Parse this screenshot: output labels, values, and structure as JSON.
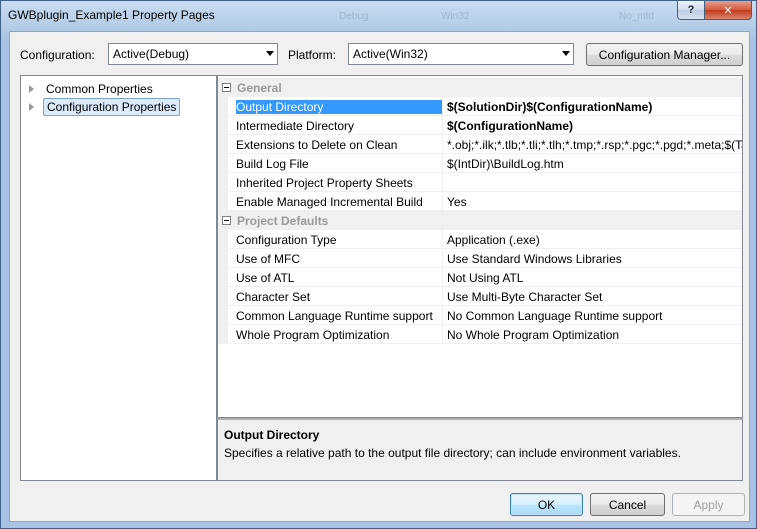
{
  "window": {
    "title": "GWBplugin_Example1 Property Pages",
    "ghost_text": [
      "Debug",
      "Win32",
      "No_mtd"
    ],
    "help_label": "?",
    "close_label": "✕"
  },
  "toolbar": {
    "configuration_label": "Configuration:",
    "configuration_value": "Active(Debug)",
    "platform_label": "Platform:",
    "platform_value": "Active(Win32)",
    "config_manager_label": "Configuration Manager..."
  },
  "tree": {
    "items": [
      {
        "label": "Common Properties",
        "selected": false
      },
      {
        "label": "Configuration Properties",
        "selected": true
      }
    ]
  },
  "grid": {
    "categories": [
      {
        "name": "General",
        "rows": [
          {
            "name": "Output Directory",
            "value": "$(SolutionDir)$(ConfigurationName)",
            "bold": true,
            "selected": true
          },
          {
            "name": "Intermediate Directory",
            "value": "$(ConfigurationName)",
            "bold": true
          },
          {
            "name": "Extensions to Delete on Clean",
            "value": "*.obj;*.ilk;*.tlb;*.tli;*.tlh;*.tmp;*.rsp;*.pgc;*.pgd;*.meta;$(TargetPath)"
          },
          {
            "name": "Build Log File",
            "value": "$(IntDir)\\BuildLog.htm"
          },
          {
            "name": "Inherited Project Property Sheets",
            "value": ""
          },
          {
            "name": "Enable Managed Incremental Build",
            "value": "Yes"
          }
        ]
      },
      {
        "name": "Project Defaults",
        "rows": [
          {
            "name": "Configuration Type",
            "value": "Application (.exe)"
          },
          {
            "name": "Use of MFC",
            "value": "Use Standard Windows Libraries"
          },
          {
            "name": "Use of ATL",
            "value": "Not Using ATL"
          },
          {
            "name": "Character Set",
            "value": "Use Multi-Byte Character Set"
          },
          {
            "name": "Common Language Runtime support",
            "value": "No Common Language Runtime support"
          },
          {
            "name": "Whole Program Optimization",
            "value": "No Whole Program Optimization"
          }
        ]
      }
    ]
  },
  "description": {
    "title": "Output Directory",
    "text": "Specifies a relative path to the output file directory; can include environment variables."
  },
  "buttons": {
    "ok": "OK",
    "cancel": "Cancel",
    "apply": "Apply"
  }
}
